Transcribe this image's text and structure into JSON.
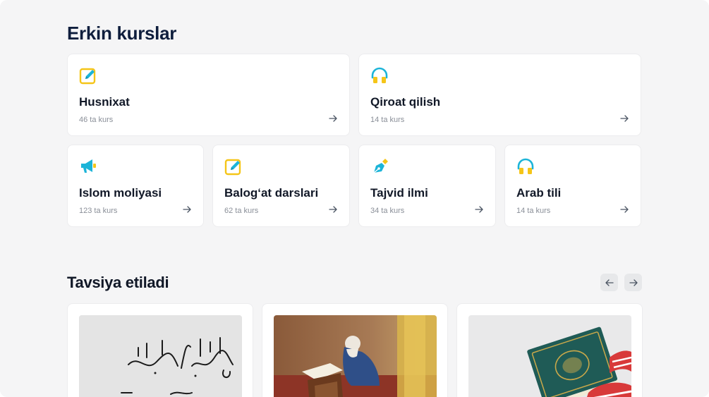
{
  "free_courses": {
    "title": "Erkin kurslar",
    "items": [
      {
        "name": "Husnixat",
        "count": "46 ta kurs",
        "icon": "edit-note-icon"
      },
      {
        "name": "Qiroat qilish",
        "count": "14 ta kurs",
        "icon": "headphones-icon"
      },
      {
        "name": "Islom moliyasi",
        "count": "123 ta kurs",
        "icon": "megaphone-icon"
      },
      {
        "name": "Balog‘at darslari",
        "count": "62 ta kurs",
        "icon": "edit-note-icon"
      },
      {
        "name": "Tajvid ilmi",
        "count": "34 ta kurs",
        "icon": "pen-nib-icon"
      },
      {
        "name": "Arab tili",
        "count": "14 ta kurs",
        "icon": "headphones-icon"
      }
    ]
  },
  "recommended": {
    "title": "Tavsiya etiladi",
    "prev_icon": "arrow-left-icon",
    "next_icon": "arrow-right-icon",
    "cards": [
      {
        "image": "calligraphy-image"
      },
      {
        "image": "man-reading-quran-image"
      },
      {
        "image": "quran-book-image"
      }
    ]
  },
  "colors": {
    "background": "#f5f5f6",
    "card": "#ffffff",
    "heading": "#0f1e3d",
    "icon_yellow": "#f5c518",
    "icon_cyan": "#1cb4d8",
    "muted_text": "#8a8f98"
  }
}
